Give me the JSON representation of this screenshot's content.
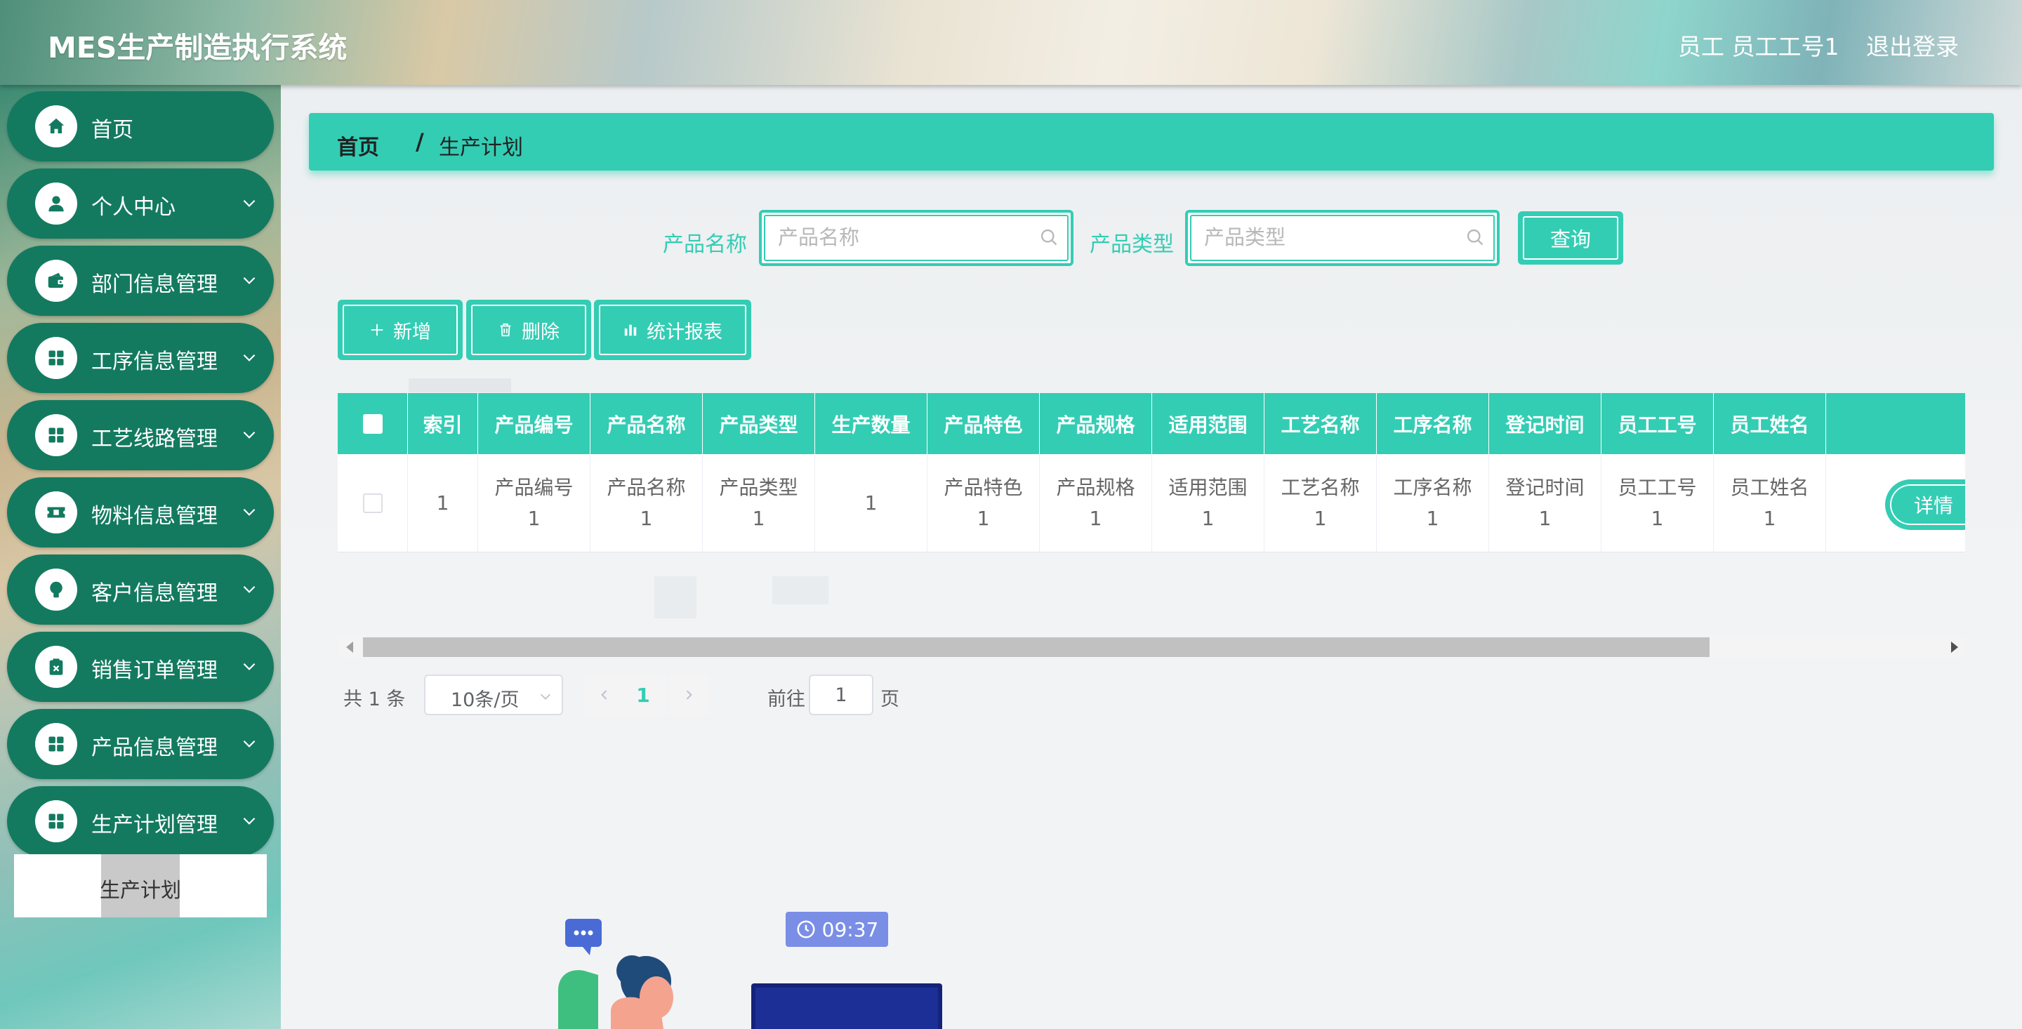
{
  "header": {
    "title": "MES生产制造执行系统",
    "user": "员工 员工工号1",
    "logout": "退出登录"
  },
  "sidebar": {
    "items": [
      {
        "label": "首页",
        "icon": "home-icon",
        "chevron": false
      },
      {
        "label": "个人中心",
        "icon": "user-icon",
        "chevron": true
      },
      {
        "label": "部门信息管理",
        "icon": "wallet-icon",
        "chevron": true
      },
      {
        "label": "工序信息管理",
        "icon": "grid-icon",
        "chevron": true
      },
      {
        "label": "工艺线路管理",
        "icon": "grid-icon",
        "chevron": true
      },
      {
        "label": "物料信息管理",
        "icon": "ticket-icon",
        "chevron": true
      },
      {
        "label": "客户信息管理",
        "icon": "lightbulb-icon",
        "chevron": true
      },
      {
        "label": "销售订单管理",
        "icon": "clipboard-icon",
        "chevron": true
      },
      {
        "label": "产品信息管理",
        "icon": "grid-icon",
        "chevron": true
      },
      {
        "label": "生产计划管理",
        "icon": "grid-icon",
        "chevron": true
      }
    ],
    "submenu": {
      "label": "生产计划"
    }
  },
  "breadcrumb": {
    "home": "首页",
    "separator": "/",
    "current": "生产计划"
  },
  "search": {
    "name_label": "产品名称",
    "name_placeholder": "产品名称",
    "type_label": "产品类型",
    "type_placeholder": "产品类型",
    "query_button": "查询"
  },
  "toolbar": {
    "add": "新增",
    "delete": "删除",
    "report": "统计报表"
  },
  "table": {
    "columns": [
      "索引",
      "产品编号",
      "产品名称",
      "产品类型",
      "生产数量",
      "产品特色",
      "产品规格",
      "适用范围",
      "工艺名称",
      "工序名称",
      "登记时间",
      "员工工号",
      "员工姓名"
    ],
    "rows": [
      {
        "cells": [
          "1",
          "产品编号1",
          "产品名称1",
          "产品类型1",
          "1",
          "产品特色1",
          "产品规格1",
          "适用范围1",
          "工艺名称1",
          "工序名称1",
          "登记时间1",
          "员工工号1",
          "员工姓名1"
        ],
        "action": "详情"
      }
    ]
  },
  "pagination": {
    "total": "共 1 条",
    "page_size": "10条/页",
    "current_page": "1",
    "goto_label": "前往",
    "goto_value": "1",
    "page_suffix": "页"
  },
  "illustration": {
    "clock": "09:37"
  },
  "colors": {
    "accent": "#33cdb4",
    "sidebar_item": "#137a60"
  }
}
